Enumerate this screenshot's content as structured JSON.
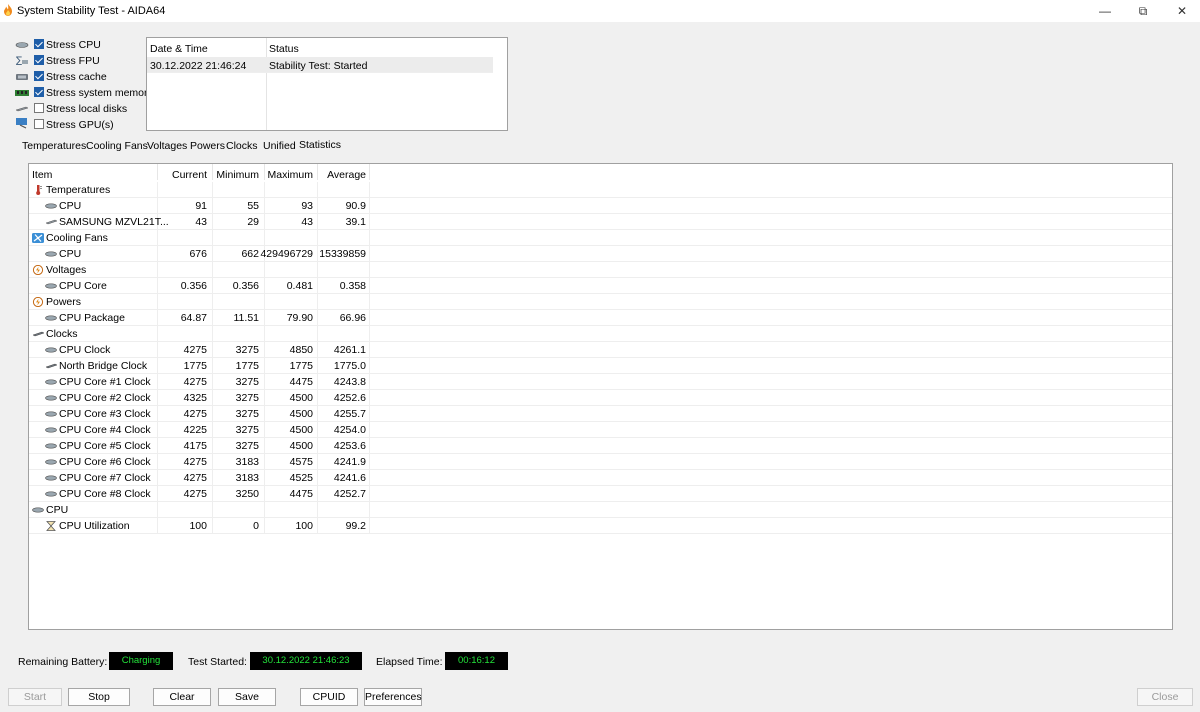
{
  "window": {
    "title": "System Stability Test - AIDA64"
  },
  "window_controls": {
    "minimize": "—",
    "restore": "⧉",
    "close": "✕"
  },
  "stress_options": [
    {
      "label": "Stress CPU",
      "checked": true
    },
    {
      "label": "Stress FPU",
      "checked": true
    },
    {
      "label": "Stress cache",
      "checked": true
    },
    {
      "label": "Stress system memory",
      "checked": true
    },
    {
      "label": "Stress local disks",
      "checked": false
    },
    {
      "label": "Stress GPU(s)",
      "checked": false
    }
  ],
  "log": {
    "headers": {
      "date": "Date & Time",
      "status": "Status"
    },
    "rows": [
      {
        "date": "30.12.2022 21:46:24",
        "status": "Stability Test: Started"
      }
    ]
  },
  "tabs": [
    {
      "label": "Temperatures",
      "active": false
    },
    {
      "label": "Cooling Fans",
      "active": false
    },
    {
      "label": "Voltages",
      "active": false
    },
    {
      "label": "Powers",
      "active": false
    },
    {
      "label": "Clocks",
      "active": false
    },
    {
      "label": "Unified",
      "active": false
    },
    {
      "label": "Statistics",
      "active": true
    }
  ],
  "stats": {
    "headers": {
      "item": "Item",
      "current": "Current",
      "minimum": "Minimum",
      "maximum": "Maximum",
      "average": "Average"
    },
    "rows": [
      {
        "type": "group",
        "label": "Temperatures",
        "icon": "thermometer-icon"
      },
      {
        "type": "item",
        "label": "CPU",
        "icon": "cpu-chip-icon",
        "current": "91",
        "minimum": "55",
        "maximum": "93",
        "average": "90.9"
      },
      {
        "type": "item",
        "label": "SAMSUNG MZVL21T...",
        "icon": "disk-icon",
        "current": "43",
        "minimum": "29",
        "maximum": "43",
        "average": "39.1"
      },
      {
        "type": "group",
        "label": "Cooling Fans",
        "icon": "fan-icon"
      },
      {
        "type": "item",
        "label": "CPU",
        "icon": "cpu-chip-icon",
        "current": "676",
        "minimum": "662",
        "maximum": "429496729",
        "average": "15339859"
      },
      {
        "type": "group",
        "label": "Voltages",
        "icon": "voltage-icon"
      },
      {
        "type": "item",
        "label": "CPU Core",
        "icon": "cpu-chip-icon",
        "current": "0.356",
        "minimum": "0.356",
        "maximum": "0.481",
        "average": "0.358"
      },
      {
        "type": "group",
        "label": "Powers",
        "icon": "power-icon"
      },
      {
        "type": "item",
        "label": "CPU Package",
        "icon": "cpu-chip-icon",
        "current": "64.87",
        "minimum": "11.51",
        "maximum": "79.90",
        "average": "66.96"
      },
      {
        "type": "group",
        "label": "Clocks",
        "icon": "clock-chip-icon"
      },
      {
        "type": "item",
        "label": "CPU Clock",
        "icon": "cpu-chip-icon",
        "current": "4275",
        "minimum": "3275",
        "maximum": "4850",
        "average": "4261.1"
      },
      {
        "type": "item",
        "label": "North Bridge Clock",
        "icon": "chipset-icon",
        "current": "1775",
        "minimum": "1775",
        "maximum": "1775",
        "average": "1775.0"
      },
      {
        "type": "item",
        "label": "CPU Core #1 Clock",
        "icon": "cpu-chip-icon",
        "current": "4275",
        "minimum": "3275",
        "maximum": "4475",
        "average": "4243.8"
      },
      {
        "type": "item",
        "label": "CPU Core #2 Clock",
        "icon": "cpu-chip-icon",
        "current": "4325",
        "minimum": "3275",
        "maximum": "4500",
        "average": "4252.6"
      },
      {
        "type": "item",
        "label": "CPU Core #3 Clock",
        "icon": "cpu-chip-icon",
        "current": "4275",
        "minimum": "3275",
        "maximum": "4500",
        "average": "4255.7"
      },
      {
        "type": "item",
        "label": "CPU Core #4 Clock",
        "icon": "cpu-chip-icon",
        "current": "4225",
        "minimum": "3275",
        "maximum": "4500",
        "average": "4254.0"
      },
      {
        "type": "item",
        "label": "CPU Core #5 Clock",
        "icon": "cpu-chip-icon",
        "current": "4175",
        "minimum": "3275",
        "maximum": "4500",
        "average": "4253.6"
      },
      {
        "type": "item",
        "label": "CPU Core #6 Clock",
        "icon": "cpu-chip-icon",
        "current": "4275",
        "minimum": "3183",
        "maximum": "4575",
        "average": "4241.9"
      },
      {
        "type": "item",
        "label": "CPU Core #7 Clock",
        "icon": "cpu-chip-icon",
        "current": "4275",
        "minimum": "3183",
        "maximum": "4525",
        "average": "4241.6"
      },
      {
        "type": "item",
        "label": "CPU Core #8 Clock",
        "icon": "cpu-chip-icon",
        "current": "4275",
        "minimum": "3250",
        "maximum": "4475",
        "average": "4252.7"
      },
      {
        "type": "group",
        "label": "CPU",
        "icon": "cpu-chip-icon"
      },
      {
        "type": "item",
        "label": "CPU Utilization",
        "icon": "hourglass-icon",
        "current": "100",
        "minimum": "0",
        "maximum": "100",
        "average": "99.2"
      }
    ]
  },
  "status_bar": {
    "battery_label": "Remaining Battery:",
    "battery_value": "Charging",
    "started_label": "Test Started:",
    "started_value": "30.12.2022 21:46:23",
    "elapsed_label": "Elapsed Time:",
    "elapsed_value": "00:16:12"
  },
  "buttons": {
    "start": "Start",
    "stop": "Stop",
    "clear": "Clear",
    "save": "Save",
    "cpuid": "CPUID",
    "preferences": "Preferences",
    "close": "Close"
  },
  "colors": {
    "lcd_bg": "#000000",
    "lcd_text": "#23e23a",
    "checkbox": "#1f5ea8"
  }
}
